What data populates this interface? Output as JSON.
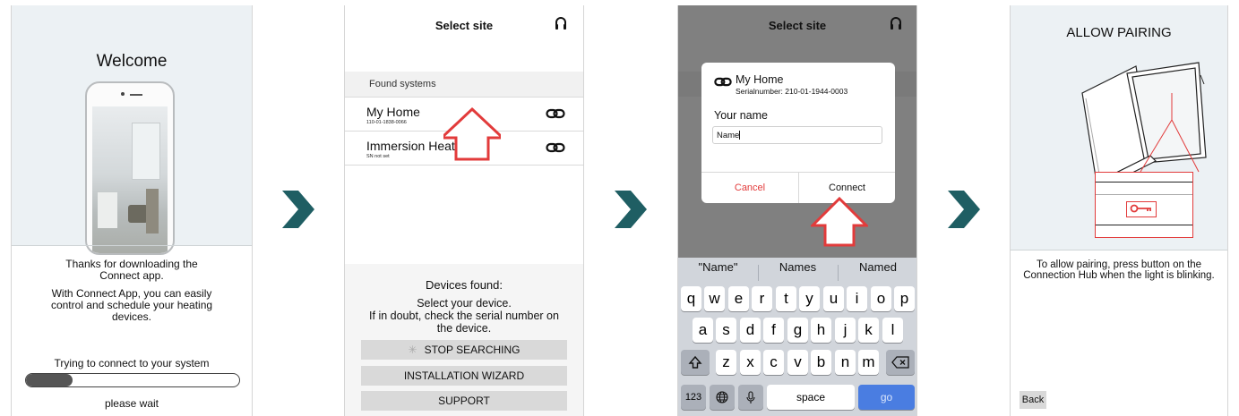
{
  "screen1": {
    "title": "Welcome",
    "thanks": "Thanks for downloading the Connect app.",
    "description": "With Connect App, you can easily control and schedule your heating devices.",
    "status": "Trying to connect to your system",
    "progress": 0.22,
    "wait": "please wait"
  },
  "screen2": {
    "title": "Select site",
    "section": "Found systems",
    "items": [
      {
        "name": "My Home",
        "serial": "110-01-1838-0066"
      },
      {
        "name": "Immersion Heater",
        "serial": "SN not set"
      }
    ],
    "devices_found": "Devices found:",
    "instruction": "Select your device.\nIf in doubt, check the serial number on the device.",
    "buttons": {
      "stop": "STOP SEARCHING",
      "wizard": "INSTALLATION WIZARD",
      "support": "SUPPORT"
    }
  },
  "screen3": {
    "title": "Select site",
    "dialog": {
      "device_name": "My Home",
      "serial": "Serialnumber: 210-01-1944-0003",
      "label": "Your name",
      "value": "Name",
      "cancel": "Cancel",
      "connect": "Connect"
    },
    "suggestions": [
      "\"Name\"",
      "Names",
      "Named"
    ],
    "keyboard": {
      "row1": [
        "q",
        "w",
        "e",
        "r",
        "t",
        "y",
        "u",
        "i",
        "o",
        "p"
      ],
      "row2": [
        "a",
        "s",
        "d",
        "f",
        "g",
        "h",
        "j",
        "k",
        "l"
      ],
      "row3": [
        "z",
        "x",
        "c",
        "v",
        "b",
        "n",
        "m"
      ],
      "numbers": "123",
      "space": "space",
      "go": "go"
    }
  },
  "screen4": {
    "title": "ALLOW PAIRING",
    "instruction": "To allow pairing, press button on the Connection Hub when the light is blinking.",
    "back": "Back"
  },
  "colors": {
    "arrow": "#1f5e63",
    "cancel": "#e23b3b",
    "go": "#4a7de1",
    "highlight": "#e23b3b"
  }
}
